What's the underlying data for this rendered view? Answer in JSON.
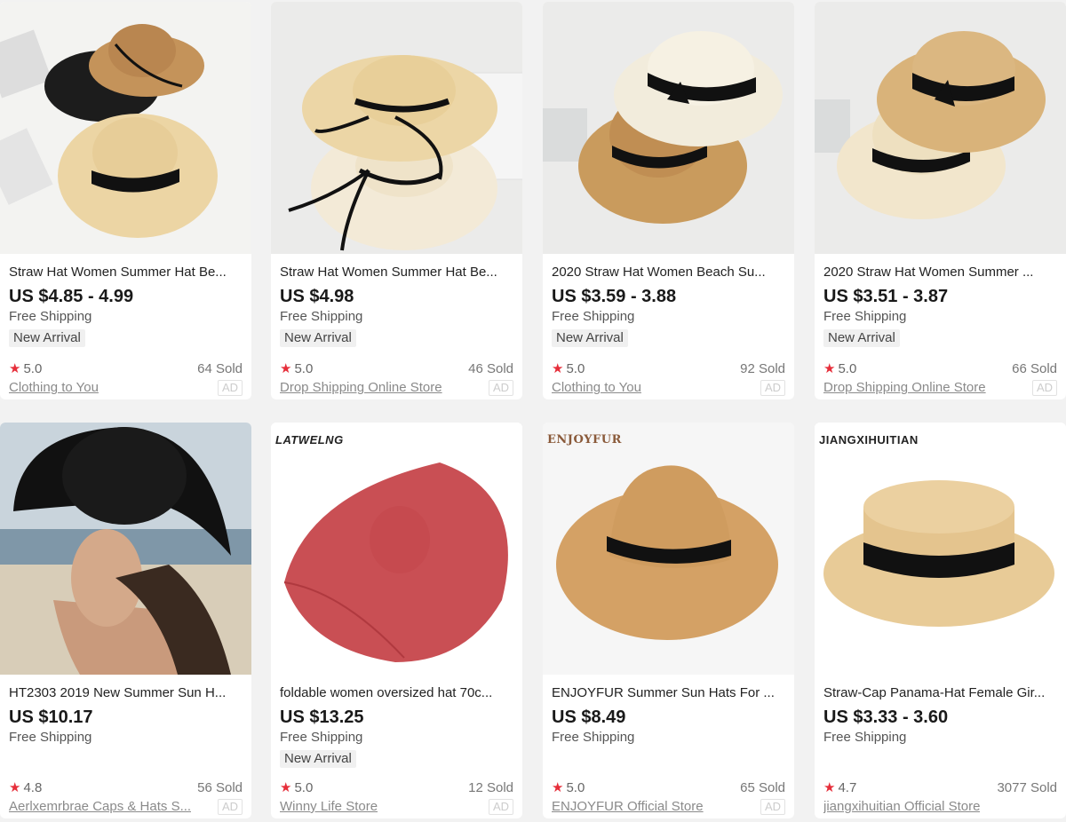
{
  "products": [
    {
      "title": "Straw Hat Women Summer Hat Be...",
      "price": "US $4.85 - 4.99",
      "shipping": "Free Shipping",
      "badge": "New Arrival",
      "rating": "5.0",
      "sold": "64 Sold",
      "store": "Clothing to You",
      "ad": "AD"
    },
    {
      "title": "Straw Hat Women Summer Hat Be...",
      "price": "US $4.98",
      "shipping": "Free Shipping",
      "badge": "New Arrival",
      "rating": "5.0",
      "sold": "46 Sold",
      "store": "Drop Shipping Online Store",
      "ad": "AD"
    },
    {
      "title": "2020 Straw Hat Women Beach Su...",
      "price": "US $3.59 - 3.88",
      "shipping": "Free Shipping",
      "badge": "New Arrival",
      "rating": "5.0",
      "sold": "92 Sold",
      "store": "Clothing to You",
      "ad": "AD"
    },
    {
      "title": "2020 Straw Hat Women Summer ...",
      "price": "US $3.51 - 3.87",
      "shipping": "Free Shipping",
      "badge": "New Arrival",
      "rating": "5.0",
      "sold": "66 Sold",
      "store": "Drop Shipping Online Store",
      "ad": "AD"
    },
    {
      "title": "HT2303 2019 New Summer Sun H...",
      "price": "US $10.17",
      "shipping": "Free Shipping",
      "rating": "4.8",
      "sold": "56 Sold",
      "store": "Aerlxemrbrae Caps & Hats S...",
      "ad": "AD"
    },
    {
      "title": "foldable women oversized hat 70c...",
      "price": "US $13.25",
      "shipping": "Free Shipping",
      "badge": "New Arrival",
      "rating": "5.0",
      "sold": "12 Sold",
      "store": "Winny Life Store",
      "ad": "AD",
      "brand": "LATWELNG"
    },
    {
      "title": "ENJOYFUR Summer Sun Hats For ...",
      "price": "US $8.49",
      "shipping": "Free Shipping",
      "rating": "5.0",
      "sold": "65 Sold",
      "store": "ENJOYFUR Official Store",
      "ad": "AD",
      "brand": "ENJOYFUR"
    },
    {
      "title": "Straw-Cap Panama-Hat Female Gir...",
      "price": "US $3.33 - 3.60",
      "shipping": "Free Shipping",
      "rating": "4.7",
      "sold": "3077 Sold",
      "store": "jiangxihuitian Official Store",
      "brand": "JIANGXIHUITIAN"
    }
  ],
  "icons": {
    "rating": "star-icon"
  },
  "colors": {
    "star": "#e62e3a",
    "page_bg": "#f2f2f2"
  }
}
